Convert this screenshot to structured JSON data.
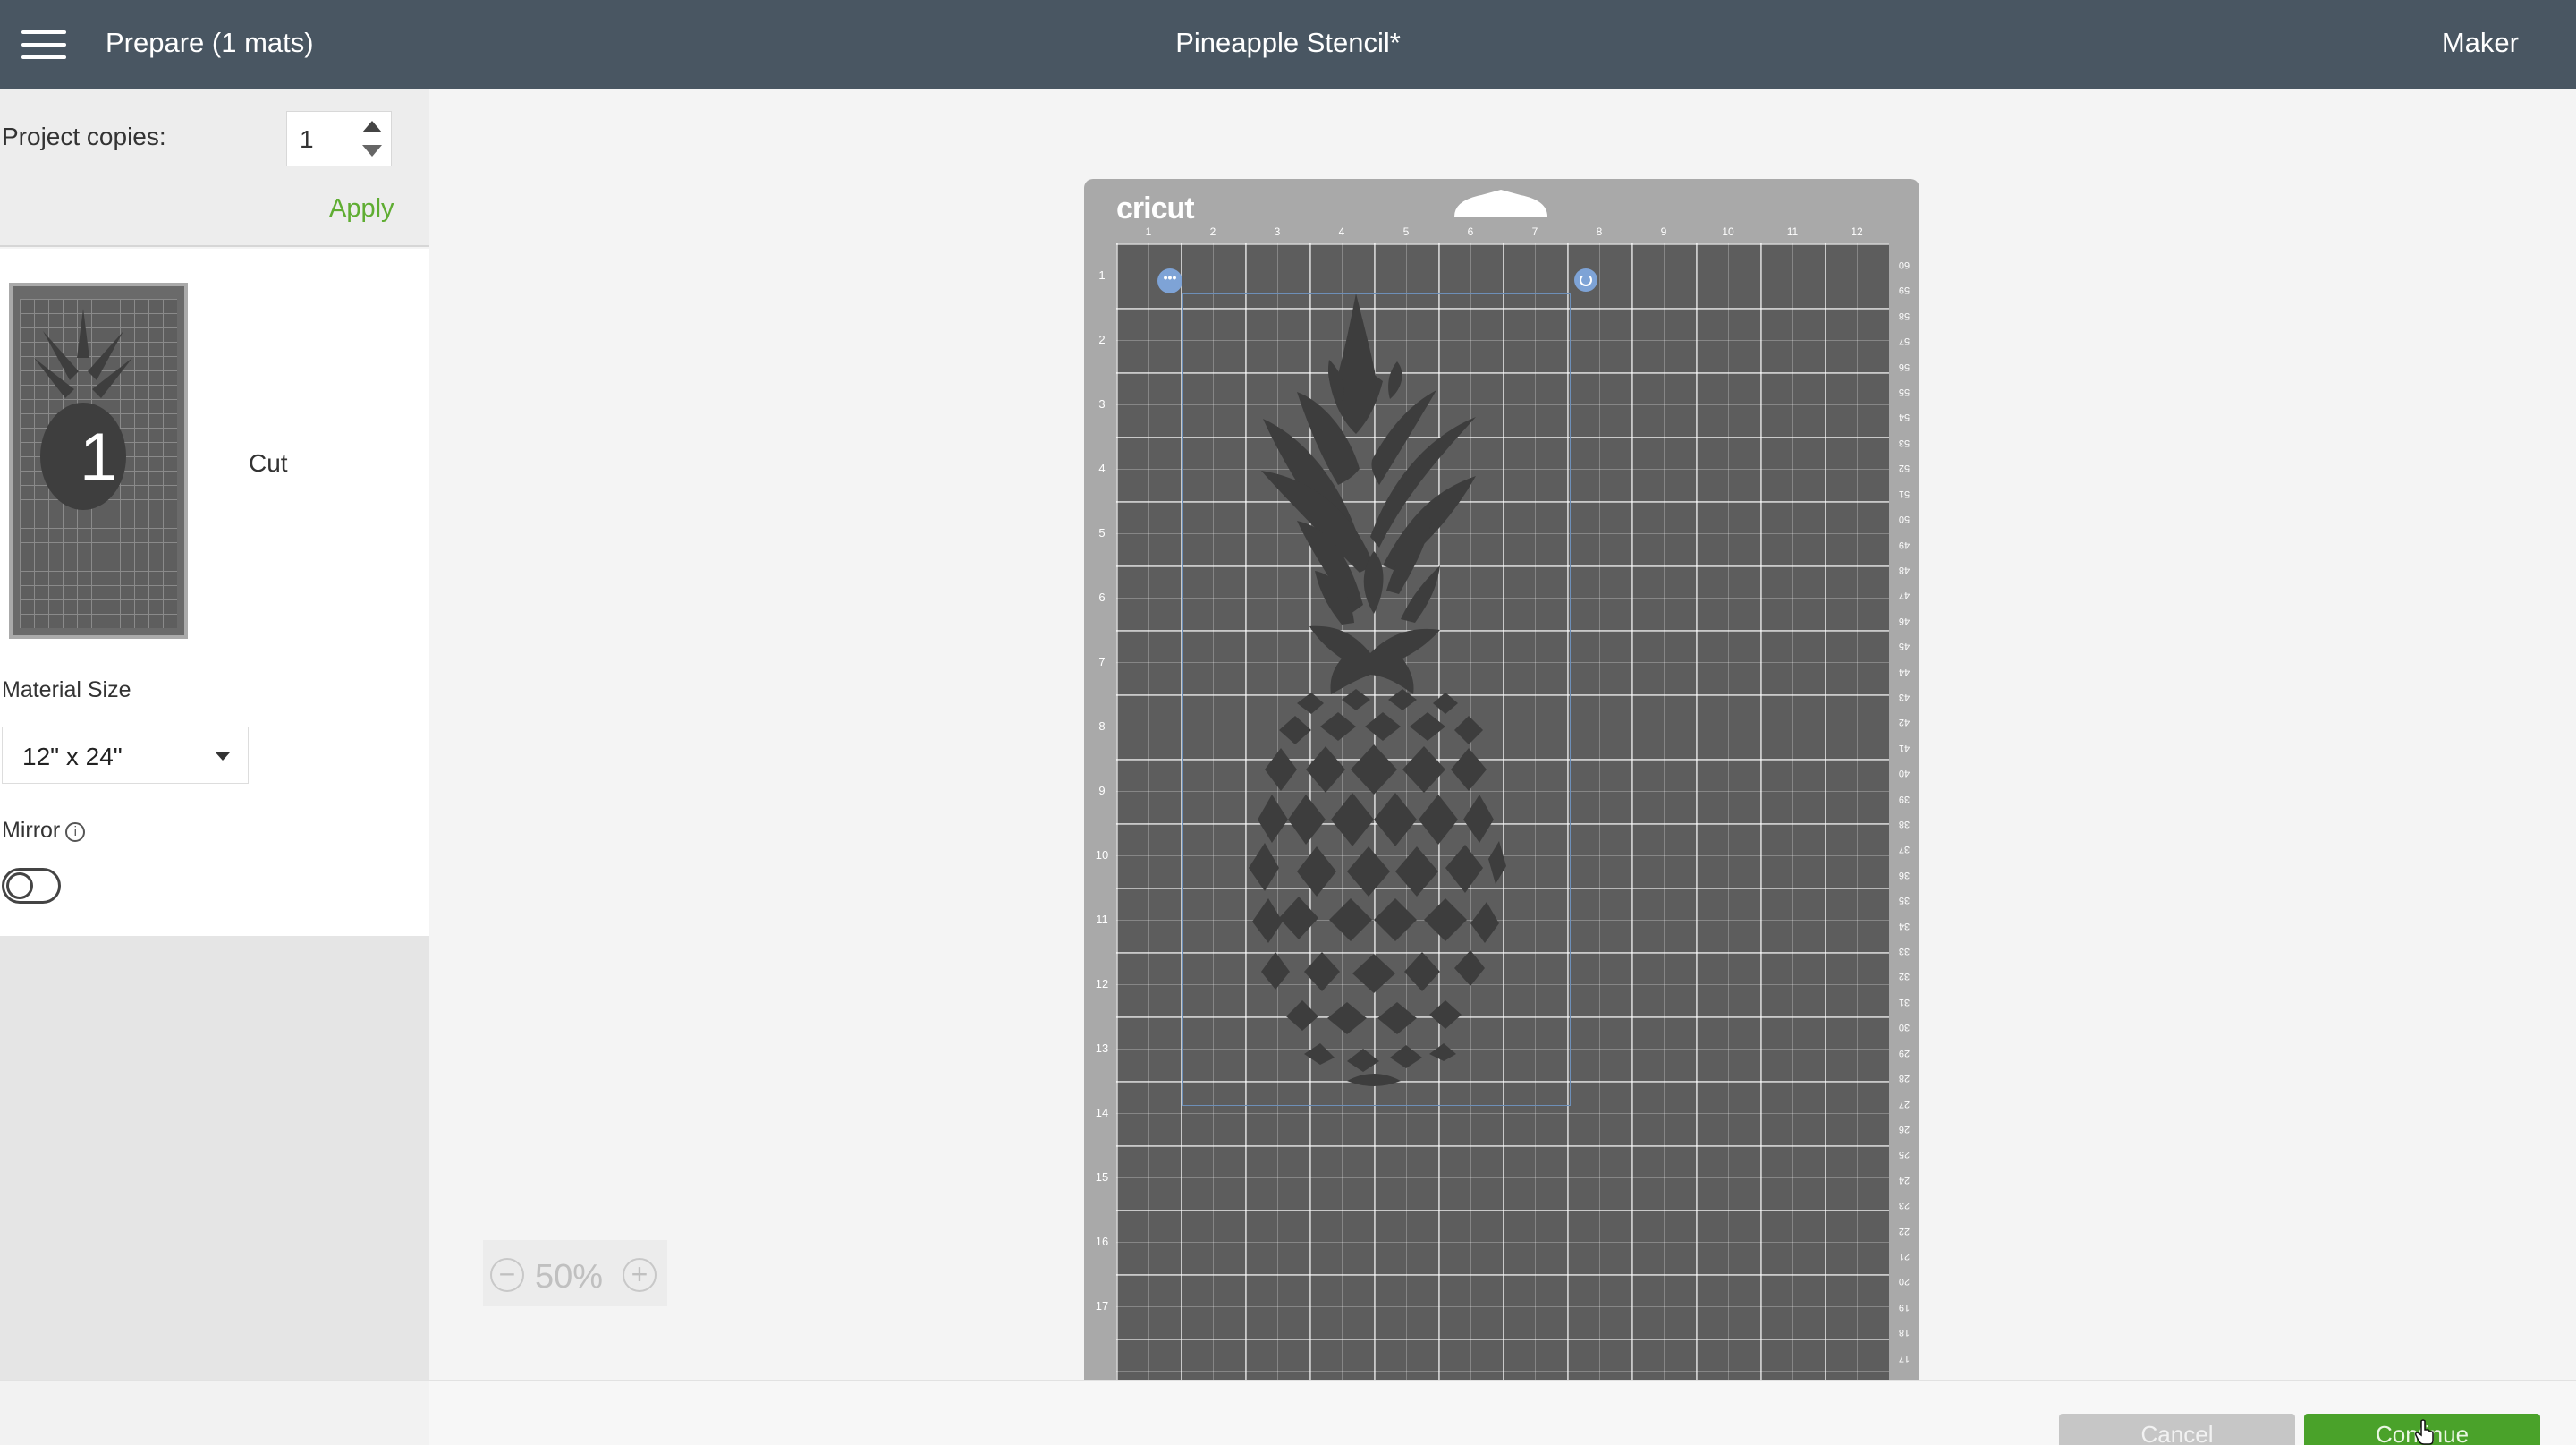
{
  "header": {
    "prepare_title": "Prepare (1 mats)",
    "project_title": "Pineapple Stencil*",
    "machine": "Maker"
  },
  "copies": {
    "label": "Project copies:",
    "value": "1",
    "apply_label": "Apply"
  },
  "mat_list": [
    {
      "number": "1",
      "operation": "Cut"
    }
  ],
  "material": {
    "label": "Material Size",
    "selected": "12\" x 24\""
  },
  "mirror": {
    "label": "Mirror",
    "info_glyph": "i",
    "enabled": false
  },
  "zoom": {
    "level": "50%",
    "minus": "−",
    "plus": "+"
  },
  "mat": {
    "brand": "cricut",
    "ruler_top": [
      "1",
      "2",
      "3",
      "4",
      "5",
      "6",
      "7",
      "8",
      "9",
      "10",
      "11",
      "12"
    ],
    "ruler_left": [
      "1",
      "2",
      "3",
      "4",
      "5",
      "6",
      "7",
      "8",
      "9",
      "10",
      "11",
      "12",
      "13",
      "14",
      "15",
      "16",
      "17"
    ],
    "ruler_right": [
      "60",
      "59",
      "58",
      "57",
      "56",
      "55",
      "54",
      "53",
      "52",
      "51",
      "50",
      "49",
      "48",
      "47",
      "46",
      "45",
      "44",
      "43",
      "42",
      "41",
      "40",
      "39",
      "38",
      "37",
      "36",
      "35",
      "34",
      "33",
      "32",
      "31",
      "30",
      "29",
      "28",
      "27",
      "26",
      "25",
      "24",
      "23",
      "22",
      "21",
      "20",
      "19",
      "18",
      "17"
    ],
    "handle_dots": "•••"
  },
  "footer": {
    "cancel": "Cancel",
    "continue": "Continue"
  },
  "colors": {
    "header_bg": "#495662",
    "accent_green": "#4aa22a",
    "apply_green": "#5fad32",
    "mat_grey": "#5d5d5d",
    "selection_blue": "#7ea3d6",
    "design_fill": "#3d3d3d"
  }
}
